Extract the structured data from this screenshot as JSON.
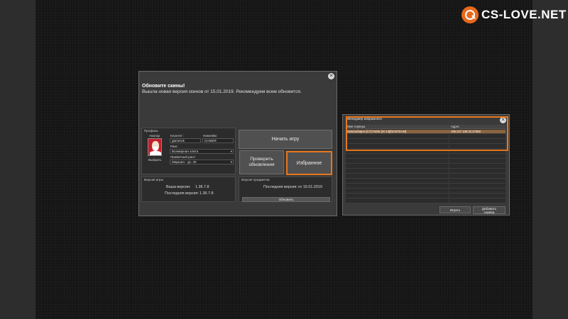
{
  "brand": {
    "logo_text": "CS-LOVE.NET",
    "accent_color": "#e8771d"
  },
  "launcher": {
    "notice_title": "Обновите скины!",
    "notice_text": "Вышла новая версия скинов от 15.01.2019. Рекомендуем всем обновится.",
    "profile": {
      "section_label": "Профиль",
      "avatar_label": "Аватар",
      "choose_button": "Выбрать",
      "clantag_label": "Клантег :",
      "clantag_value": "gamerok",
      "nickname_label": "Никнейм:",
      "nickname_value": "GAMER",
      "rank_label": "Ранг:",
      "rank_value": "Всемирная элита",
      "private_rank_label": "Приватный ранг:",
      "private_rank_value": "Маршал - ур. 40"
    },
    "play_button": "Начать игру",
    "check_updates_button": [
      "Проверить",
      "обновления"
    ],
    "favorites_button": "Избранное",
    "game_version": {
      "section_label": "Версия игры",
      "your_version_label": "Ваша версия:",
      "your_version": "1.36.7.8",
      "latest_version_label": "Последняя версия:",
      "latest_version": "1.36.7.8"
    },
    "items_version": {
      "section_label": "Версия предметов",
      "latest_label": "Последняя версия:",
      "latest_value": "от 15.01.2019",
      "update_button": "Обновить"
    }
  },
  "favorites_manager": {
    "title": "Менеджер избранного",
    "columns": [
      "Имя сервера",
      "Адрес"
    ],
    "rows": [
      {
        "name": "Новосибирск [C7] Public [IX-14][NOSTEAM]",
        "address": "185.227.108.31:27380"
      }
    ],
    "play_button": "Играть",
    "add_server_button": [
      "Добавить",
      "сервер"
    ]
  }
}
